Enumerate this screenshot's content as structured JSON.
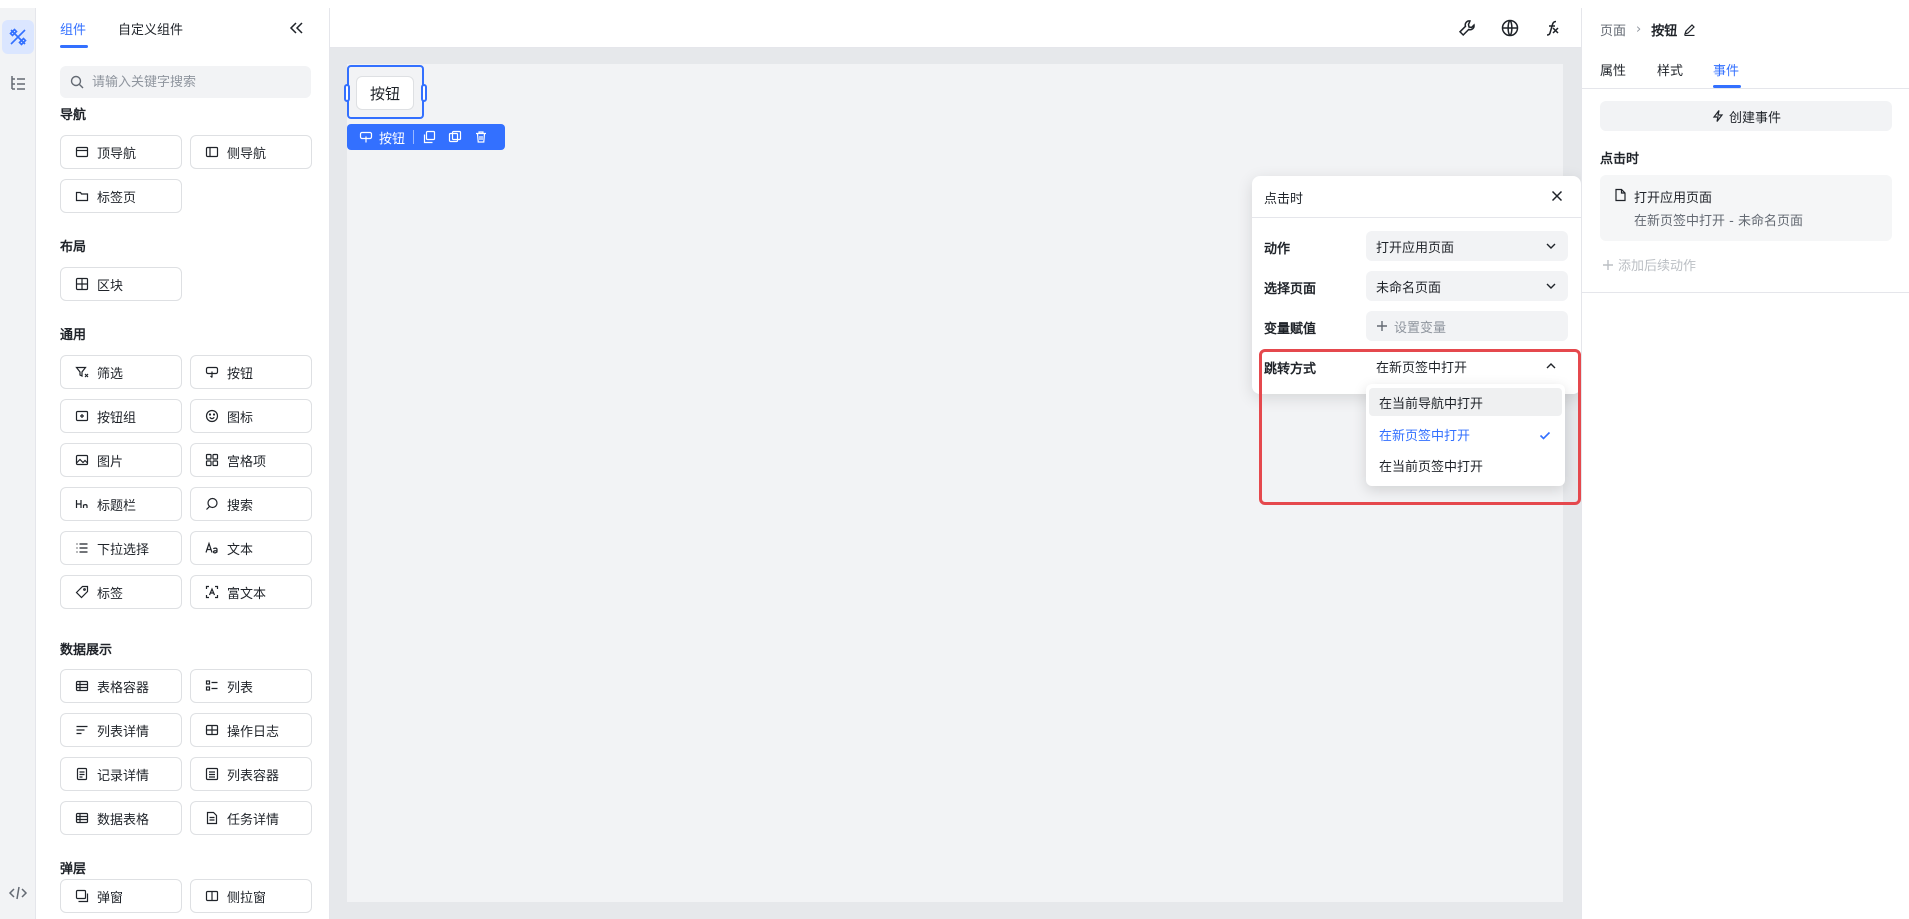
{
  "left_panel": {
    "tabs": [
      "组件",
      "自定义组件"
    ],
    "search_placeholder": "请输入关键字搜索",
    "sections": {
      "nav": {
        "title": "导航",
        "items": [
          "顶导航",
          "侧导航",
          "标签页"
        ]
      },
      "layout": {
        "title": "布局",
        "items": [
          "区块"
        ]
      },
      "general": {
        "title": "通用",
        "items": [
          "筛选",
          "按钮",
          "按钮组",
          "图标",
          "图片",
          "宫格项",
          "标题栏",
          "搜索",
          "下拉选择",
          "文本",
          "标签",
          "富文本"
        ]
      },
      "data": {
        "title": "数据展示",
        "items": [
          "表格容器",
          "列表",
          "列表详情",
          "操作日志",
          "记录详情",
          "列表容器",
          "数据表格",
          "任务详情"
        ]
      },
      "overlay": {
        "title": "弹层",
        "items": [
          "弹窗",
          "侧拉窗"
        ]
      }
    }
  },
  "canvas": {
    "button_label": "按钮",
    "toolbar_label": "按钮"
  },
  "event_popup": {
    "title": "点击时",
    "rows": [
      {
        "label": "动作",
        "value": "打开应用页面"
      },
      {
        "label": "选择页面",
        "value": "未命名页面"
      },
      {
        "label": "变量赋值",
        "value": "设置变量"
      },
      {
        "label": "跳转方式",
        "value": "在新页签中打开"
      }
    ],
    "dropdown_options": [
      "在当前导航中打开",
      "在新页签中打开",
      "在当前页签中打开"
    ]
  },
  "right_panel": {
    "breadcrumb": [
      "页面",
      "按钮"
    ],
    "tabs": [
      "属性",
      "样式",
      "事件"
    ],
    "create_event": "创建事件",
    "section_title": "点击时",
    "action_title": "打开应用页面",
    "action_subtitle": "在新页签中打开 - 未命名页面",
    "add_follow": "添加后续动作"
  },
  "colors": {
    "accent": "#3370ff",
    "highlight": "#e5484d"
  }
}
